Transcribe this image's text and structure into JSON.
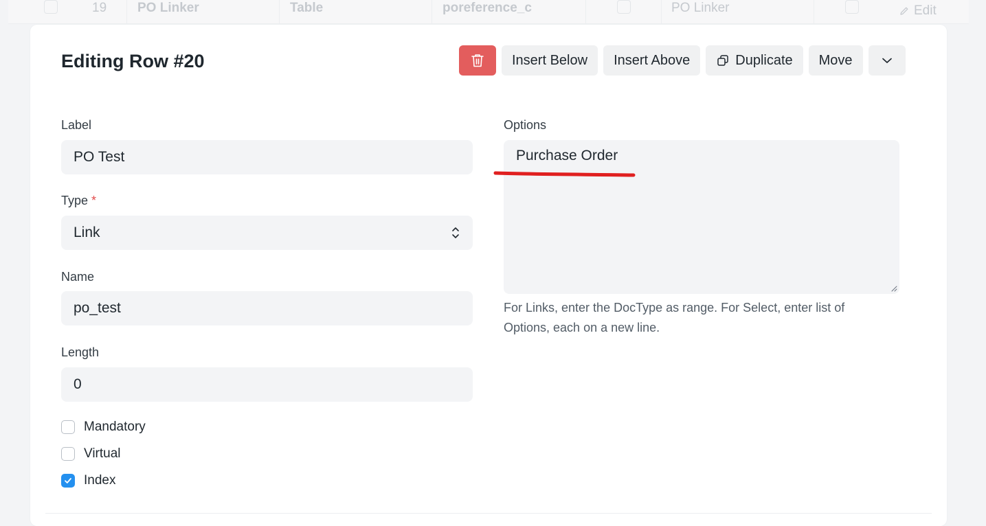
{
  "background_row": {
    "number": "19",
    "label": "PO Linker",
    "type": "Table",
    "name": "poreference_c",
    "options": "PO Linker",
    "edit_label": "Edit"
  },
  "dialog": {
    "title": "Editing Row #20",
    "toolbar": {
      "delete_icon": "trash-icon",
      "insert_below": "Insert Below",
      "insert_above": "Insert Above",
      "duplicate": "Duplicate",
      "move": "Move",
      "more_icon": "chevron-down-icon"
    }
  },
  "form": {
    "label": {
      "label": "Label",
      "value": "PO Test"
    },
    "type": {
      "label": "Type",
      "required_marker": "*",
      "value": "Link"
    },
    "name": {
      "label": "Name",
      "value": "po_test"
    },
    "length": {
      "label": "Length",
      "value": "0"
    },
    "options": {
      "label": "Options",
      "value": "Purchase Order",
      "help": "For Links, enter the DocType as range. For Select, enter list of Options, each on a new line."
    },
    "checkboxes": [
      {
        "label": "Mandatory",
        "checked": false
      },
      {
        "label": "Virtual",
        "checked": false
      },
      {
        "label": "Index",
        "checked": true
      }
    ]
  },
  "colors": {
    "danger": "#e35d5d",
    "checkbox_checked": "#2490ef",
    "annotation_underline": "#e02020",
    "input_bg": "#f3f4f6"
  }
}
